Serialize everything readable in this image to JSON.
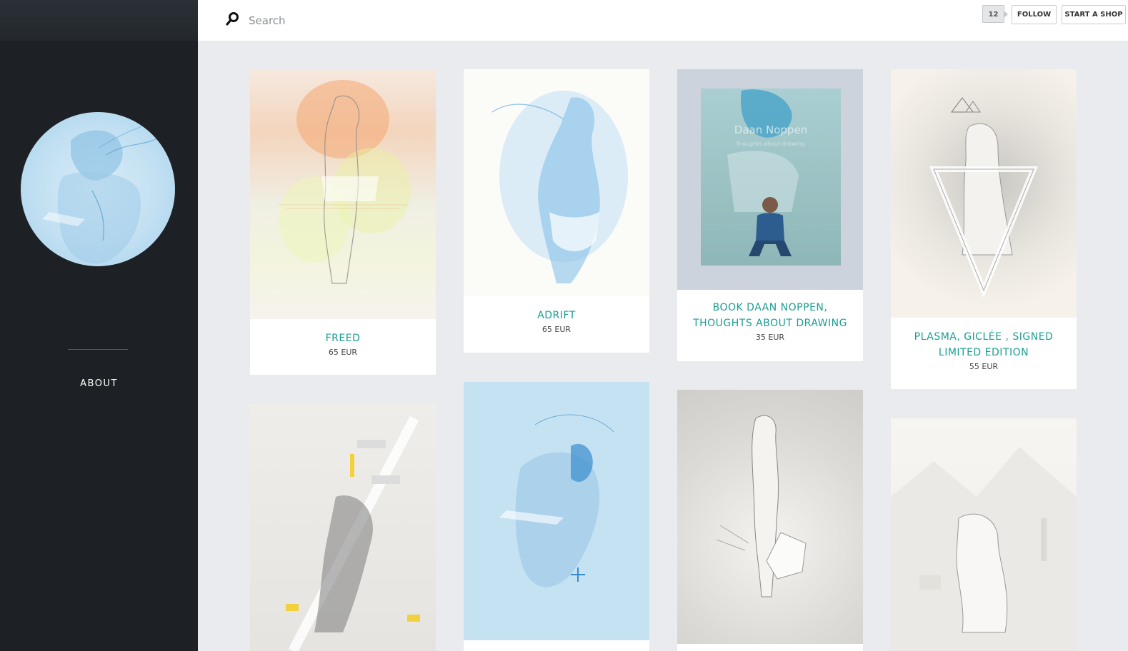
{
  "sidebar": {
    "nav": [
      {
        "label": "ABOUT"
      }
    ]
  },
  "search": {
    "placeholder": "Search"
  },
  "header": {
    "follow_count": "12",
    "follow_label": "FOLLOW",
    "shop_label": "START A SHOP"
  },
  "products": [
    {
      "title": "FREED",
      "price": "65 EUR"
    },
    {
      "title": "ADRIFT",
      "price": "65 EUR"
    },
    {
      "title": "BOOK DAAN NOPPEN, THOUGHTS ABOUT DRAWING",
      "price": "35 EUR"
    },
    {
      "title": "PLASMA, GICLÉE , SIGNED LIMITED EDITION",
      "price": "55 EUR"
    }
  ],
  "book_cover": {
    "author": "Daan Noppen",
    "subtitle": "thoughts about drawing"
  },
  "colors": {
    "accent": "#1a9e94",
    "sidebar": "#1d2125",
    "background": "#e9ebee"
  }
}
